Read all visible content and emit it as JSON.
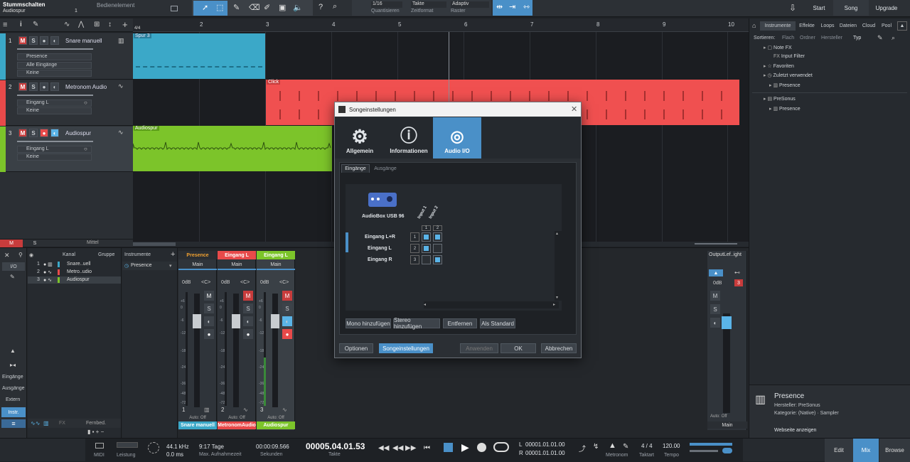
{
  "topbar": {
    "song_title": "Stummschalten",
    "track_name": "Audiospur",
    "track_sub": "1",
    "panel_label": "Bedienelement",
    "quantize_value": "1/16",
    "quantize_label": "Quantisieren",
    "timeformat_value": "Takte",
    "timeformat_label": "Zeitformat",
    "snap_value": "Adaptiv",
    "snap_label": "Raster",
    "iq_label": "IQ",
    "start_button": "Start",
    "song_button": "Song",
    "upgrade_button": "Upgrade"
  },
  "ruler": {
    "bars": [
      "2",
      "3",
      "4",
      "5",
      "6",
      "7",
      "8",
      "9",
      "10"
    ],
    "timesig": "4/4"
  },
  "tracks": [
    {
      "num": "1",
      "name": "Snare manuell",
      "instrument": "Presence",
      "input": "Alle Eingänge",
      "output": "Keine",
      "color": "#3ba8c8",
      "clip_label": "Spur 3"
    },
    {
      "num": "2",
      "name": "Metronom Audio",
      "input": "Eingang L",
      "output": "Keine",
      "color": "#e84a4a",
      "clip_label": "Click"
    },
    {
      "num": "3",
      "name": "Audiospur",
      "input": "Eingang L",
      "output": "Keine",
      "color": "#7cc42a",
      "clip_label": "Audiospur"
    }
  ],
  "track_footer": {
    "m": "M",
    "s": "S",
    "zoom": "Mittel"
  },
  "browser": {
    "tabs": [
      "Instrumente",
      "Effekte",
      "Loops",
      "Dateien",
      "Cloud",
      "Pool"
    ],
    "sort_label": "Sortieren:",
    "sort_options": [
      "Flach",
      "Ordner",
      "Hersteller",
      "Typ"
    ],
    "tree": [
      {
        "label": "Note FX",
        "indent": 1
      },
      {
        "label": "Input Filter",
        "indent": 2
      },
      {
        "label": "Favoriten",
        "indent": 1
      },
      {
        "label": "Zuletzt verwendet",
        "indent": 1
      },
      {
        "label": "Presence",
        "indent": 2
      }
    ],
    "tree2": [
      {
        "label": "PreSonus",
        "indent": 1
      },
      {
        "label": "Presence",
        "indent": 2
      }
    ],
    "info_title": "Presence",
    "info_vendor": "Hersteller: PreSonus",
    "info_category": "Kategorie: (Native) · Sampler",
    "info_link": "Webseite anzeigen"
  },
  "console": {
    "left_tabs": [
      "I/O"
    ],
    "left_items": [
      "Eingänge",
      "Ausgänge",
      "Extern",
      "Instr."
    ],
    "channel_header": "Kanal",
    "group_header": "Gruppe",
    "instruments_header": "Instrumente",
    "instrument_item": "Presence",
    "channel_list": [
      {
        "num": "1",
        "name": "Snare..uell"
      },
      {
        "num": "2",
        "name": "Metro..udio"
      },
      {
        "num": "3",
        "name": "Audiospur"
      }
    ],
    "fernbed": "Fernbed.",
    "strips": [
      {
        "top": "Presence",
        "route": "Main",
        "db": "0dB",
        "pan": "<C>",
        "auto": "Auto: Off",
        "name": "Snare manuell",
        "num": "1",
        "color": "#3ba8c8"
      },
      {
        "top": "Eingang L",
        "route": "Main",
        "db": "0dB",
        "pan": "<C>",
        "auto": "Auto: Off",
        "name": "MetronomAudio",
        "num": "2",
        "color": "#e84a4a"
      },
      {
        "top": "Eingang L",
        "route": "Main",
        "db": "0dB",
        "pan": "<C>",
        "auto": "Auto: Off",
        "name": "Audiospur",
        "num": "3",
        "color": "#7cc42a"
      }
    ],
    "fader_scale": [
      "+6",
      "0",
      "-6",
      "-12",
      "-18",
      "-24",
      "-36",
      "-48",
      "-72"
    ],
    "out_strip": {
      "top": "OutputLef..ight",
      "db": "0dB",
      "auto": "Auto: Off",
      "name": "Main",
      "meter_num": "3"
    }
  },
  "dialog": {
    "title": "Songeinstellungen",
    "tabs": [
      "Allgemein",
      "Informationen",
      "Audio I/O"
    ],
    "subtabs": [
      "Eingänge",
      "Ausgänge"
    ],
    "device_name": "AudioBox USB 96",
    "col_headers": [
      "Input 1",
      "Input 2"
    ],
    "col_nums": [
      "1",
      "2"
    ],
    "rows": [
      {
        "label": "Eingang L+R",
        "num": "1",
        "cells": [
          true,
          true
        ]
      },
      {
        "label": "Eingang L",
        "num": "2",
        "cells": [
          true,
          false
        ]
      },
      {
        "label": "Eingang R",
        "num": "3",
        "cells": [
          false,
          true
        ]
      }
    ],
    "buttons": [
      "Mono hinzufügen",
      "Stereo hinzufügen",
      "Entfernen",
      "Als Standard"
    ],
    "footer_left": [
      "Optionen",
      "Songeinstellungen"
    ],
    "footer_right": [
      "Anwenden",
      "OK",
      "Abbrechen"
    ]
  },
  "transport": {
    "midi": "MIDI",
    "perf": "Leistung",
    "samplerate": "44.1 kHz",
    "latency": "0.0 ms",
    "maxrec": "9:17 Tage",
    "maxrec_label": "Max. Aufnahmezeit",
    "seconds": "00:00:09.566",
    "seconds_label": "Sekunden",
    "position": "00005.04.01.53",
    "position_label": "Takte",
    "loop_l": "00001.01.01.00",
    "loop_r": "00001.01.01.00",
    "l": "L",
    "r": "R",
    "metronome_label": "Metronom",
    "timesig": "4 / 4",
    "timesig_label": "Taktart",
    "tempo": "120.00",
    "tempo_label": "Tempo",
    "edit": "Edit",
    "mix": "Mix",
    "browse": "Browse"
  }
}
